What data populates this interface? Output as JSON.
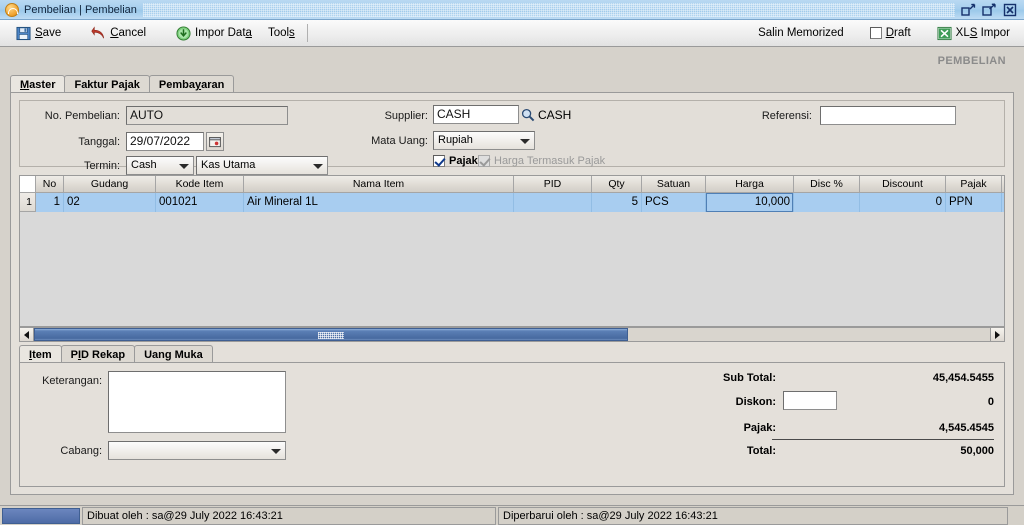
{
  "window": {
    "title": "Pembelian | Pembelian",
    "app_icon": "orange-circle-icon",
    "buttons": [
      {
        "name": "restore-window-button",
        "glyph": "restore"
      },
      {
        "name": "maximize-window-button",
        "glyph": "maximize"
      },
      {
        "name": "close-window-button",
        "glyph": "close"
      }
    ]
  },
  "toolbar": {
    "save_label": "Save",
    "cancel_label": "Cancel",
    "impor_data_label": "Impor Data",
    "tools_label": "Tools",
    "salin_memorized_label": "Salin Memorized",
    "draft_label": "Draft",
    "draft_checked": false,
    "xls_impor_label": "XLS Impor"
  },
  "module_label": "PEMBELIAN",
  "tabs": [
    {
      "label": "Master",
      "active": true
    },
    {
      "label": "Faktur Pajak",
      "active": false
    },
    {
      "label": "Pembayaran",
      "active": false
    }
  ],
  "form": {
    "no_pembelian_label": "No. Pembelian:",
    "no_pembelian_value": "AUTO",
    "tanggal_label": "Tanggal:",
    "tanggal_value": "29/07/2022",
    "termin_label": "Termin:",
    "termin_value": "Cash",
    "termin_akun_value": "Kas Utama",
    "supplier_label": "Supplier:",
    "supplier_value": "CASH",
    "supplier_name": "CASH",
    "mata_uang_label": "Mata Uang:",
    "mata_uang_value": "Rupiah",
    "pajak_label": "Pajak",
    "pajak_checked": true,
    "harga_termasuk_pajak_label": "Harga Termasuk Pajak",
    "harga_termasuk_pajak_checked": true,
    "harga_termasuk_pajak_disabled": true,
    "referensi_label": "Referensi:",
    "referensi_value": ""
  },
  "grid": {
    "columns": [
      "No",
      "Gudang",
      "Kode Item",
      "Nama Item",
      "PID",
      "Qty",
      "Satuan",
      "Harga",
      "Disc %",
      "Discount",
      "Pajak",
      ""
    ],
    "rows": [
      {
        "row_header": "1",
        "No": "1",
        "Gudang": "02",
        "Kode Item": "001021",
        "Nama Item": "Air Mineral 1L",
        "PID": "",
        "Qty": "5",
        "Satuan": "PCS",
        "Harga": "10,000",
        "Disc %": "",
        "Discount": "0",
        "Pajak": "PPN",
        "extra": ""
      }
    ]
  },
  "bottom_tabs": [
    {
      "label": "Item",
      "active": true
    },
    {
      "label": "PID Rekap",
      "active": false
    },
    {
      "label": "Uang Muka",
      "active": false
    }
  ],
  "bottom": {
    "keterangan_label": "Keterangan:",
    "keterangan_value": "",
    "cabang_label": "Cabang:",
    "cabang_value": "",
    "sub_total_label": "Sub Total:",
    "sub_total_value": "45,454.5455",
    "diskon_label": "Diskon:",
    "diskon_input_value": "",
    "diskon_value": "0",
    "pajak_label": "Pajak:",
    "pajak_value": "4,545.4545",
    "total_label": "Total:",
    "total_value": "50,000"
  },
  "status": {
    "created": "Dibuat oleh : sa@29 July 2022  16:43:21",
    "updated": "Diperbarui oleh : sa@29 July 2022  16:43:21"
  }
}
